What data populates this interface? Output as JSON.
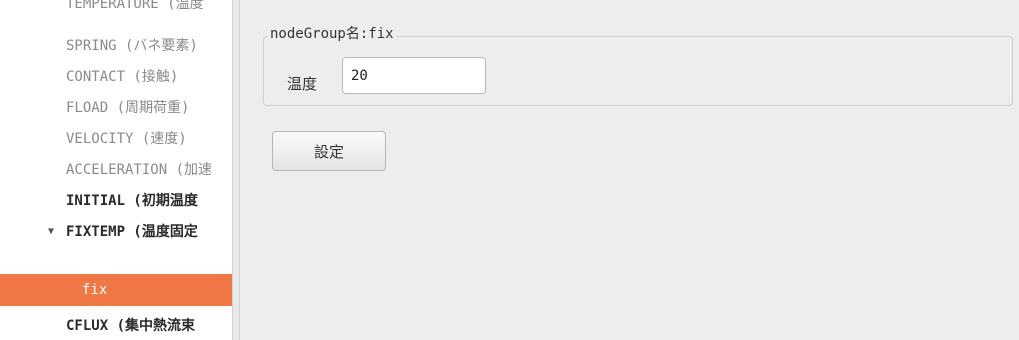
{
  "tree": {
    "items": [
      {
        "label": "TEMPERATURE (温度",
        "style": "dim"
      },
      {
        "label": "SPRING (バネ要素)",
        "style": "dim"
      },
      {
        "label": "CONTACT (接触)",
        "style": "dim"
      },
      {
        "label": "FLOAD (周期荷重)",
        "style": "dim"
      },
      {
        "label": "VELOCITY (速度)",
        "style": "dim"
      },
      {
        "label": "ACCELERATION (加速",
        "style": "dim"
      },
      {
        "label": "INITIAL (初期温度",
        "style": "bold"
      },
      {
        "label": "FIXTEMP (温度固定",
        "style": "bold",
        "expander": "▼"
      },
      {
        "label": "fix",
        "style": "selected"
      },
      {
        "label": "CFLUX (集中熱流束",
        "style": "bold"
      }
    ],
    "colors": {
      "selected_bg": "#f07746"
    }
  },
  "panel": {
    "group_legend": "nodeGroup名:fix",
    "temperature_label": "温度",
    "temperature_value": "20",
    "set_button_label": "設定"
  }
}
